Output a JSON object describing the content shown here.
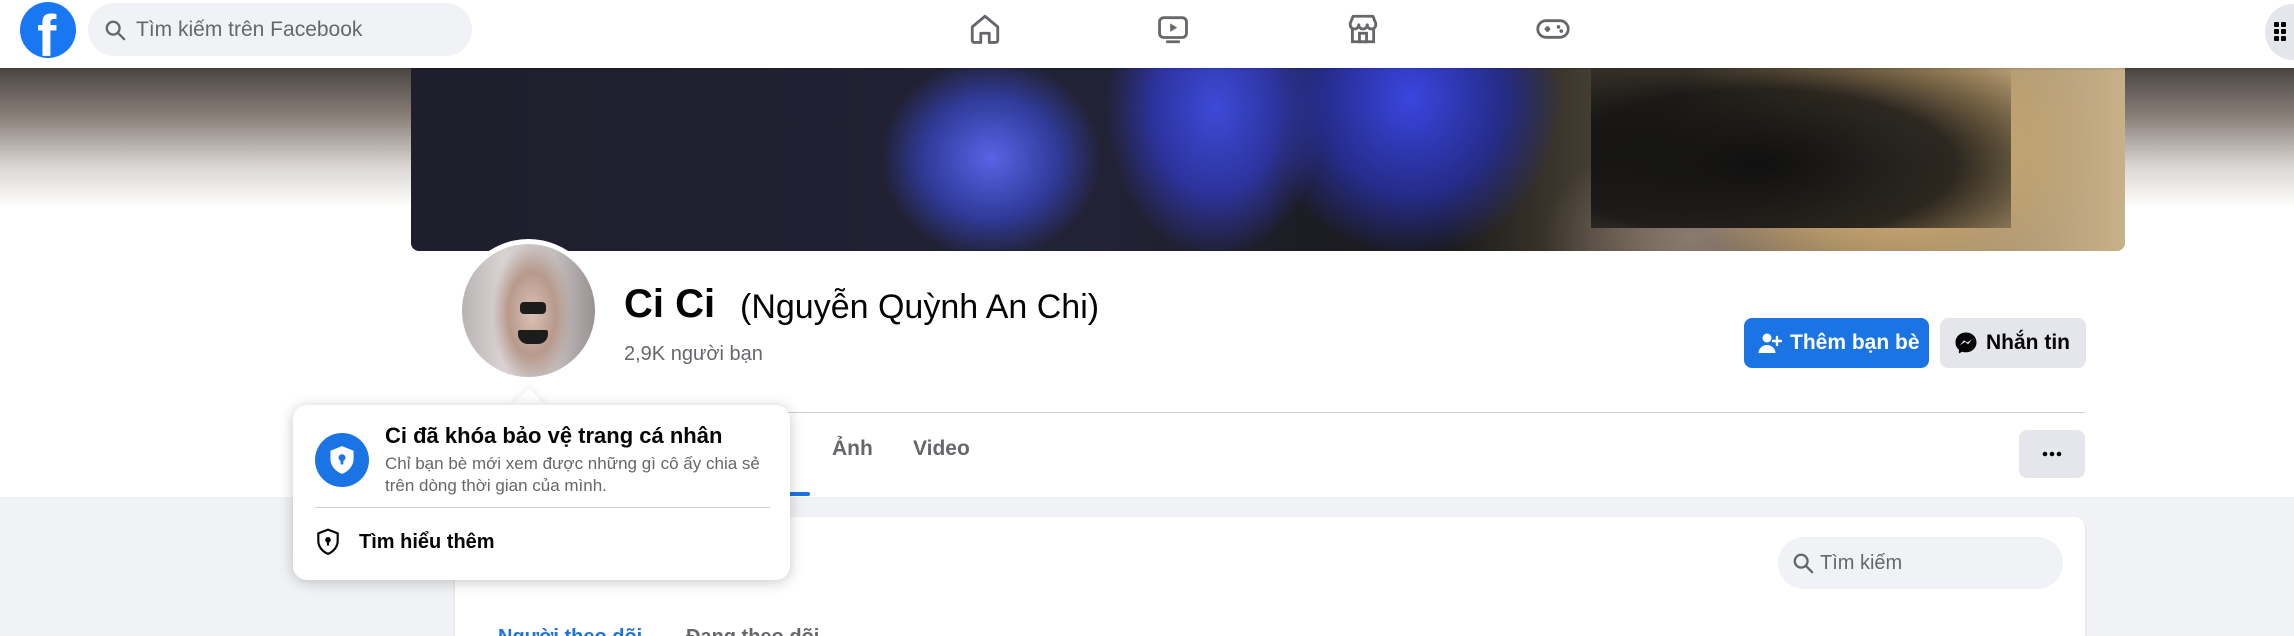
{
  "topbar": {
    "logo": "f",
    "search_placeholder": "Tìm kiếm trên Facebook",
    "nav_icons": [
      "home-icon",
      "watch-icon",
      "marketplace-icon",
      "gaming-icon"
    ],
    "menu_icon": "grid-menu-icon"
  },
  "profile": {
    "name": "Ci Ci",
    "alternate_name": "(Nguyễn Quỳnh An Chi)",
    "friend_count": "2,9K người bạn",
    "add_friend_label": "Thêm bạn bè",
    "message_label": "Nhắn tin"
  },
  "tabs": [
    {
      "label": "Ảnh"
    },
    {
      "label": "Video"
    }
  ],
  "more_label": "···",
  "content": {
    "search_placeholder": "Tìm kiếm",
    "cut_link_1": "Người theo dõi",
    "cut_link_2": "Đang theo dõi"
  },
  "popover": {
    "title": "Ci đã khóa bảo vệ trang cá nhân",
    "description": "Chỉ bạn bè mới xem được những gì cô ấy chia sẻ trên dòng thời gian của mình.",
    "link_label": "Tìm hiểu thêm"
  },
  "colors": {
    "accent": "#1b74e4",
    "facebook_blue": "#1877f2",
    "secondary_text": "#65676b",
    "button_gray": "#e4e6eb",
    "page_bg": "#f0f2f5"
  }
}
